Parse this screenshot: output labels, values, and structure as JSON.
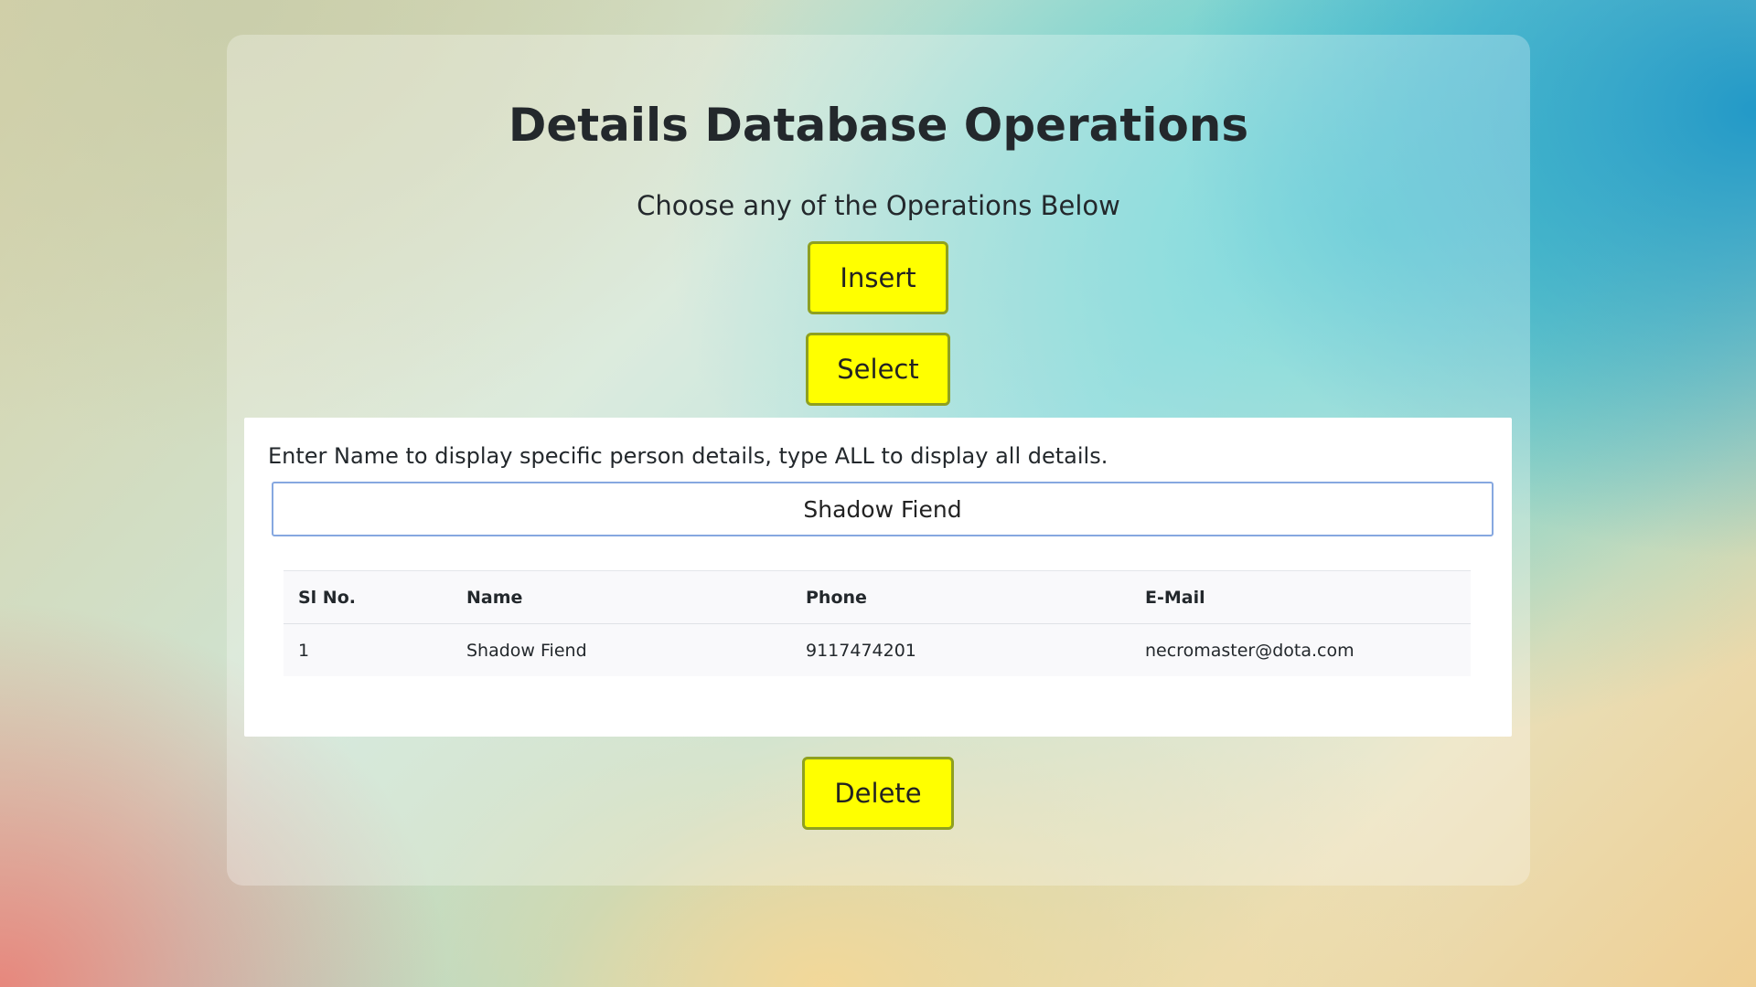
{
  "page": {
    "title": "Details Database Operations",
    "subtitle": "Choose any of the Operations Below"
  },
  "operations": {
    "insert_label": "Insert",
    "select_label": "Select",
    "delete_label": "Delete"
  },
  "select_panel": {
    "instructions": "Enter Name to display specific person details, type ALL to display all details.",
    "name_value": "Shadow Fiend"
  },
  "results_table": {
    "headers": {
      "sl": "Sl No.",
      "name": "Name",
      "phone": "Phone",
      "email": "E-Mail"
    },
    "rows": [
      {
        "sl": "1",
        "name": "Shadow Fiend",
        "phone": "9117474201",
        "email": "necromaster@dota.com"
      }
    ]
  },
  "colors": {
    "button_bg": "#ffff00",
    "button_border": "#8fa020",
    "input_border": "#86a8e0"
  }
}
